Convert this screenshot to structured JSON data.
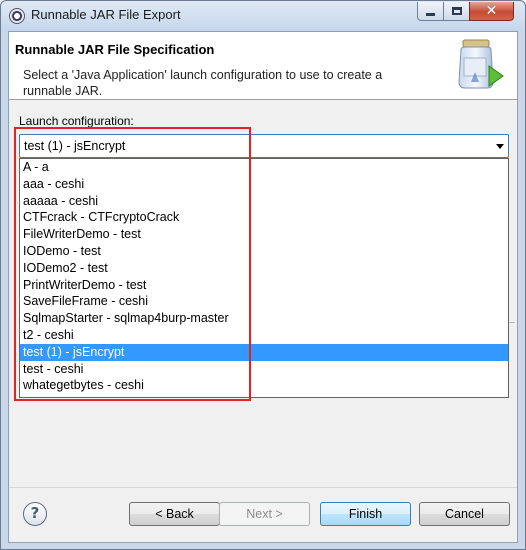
{
  "window": {
    "title": "Runnable JAR File Export"
  },
  "header": {
    "title": "Runnable JAR File Specification",
    "description": "Select a 'Java Application' launch configuration to use to create a runnable JAR."
  },
  "launch": {
    "label": "Launch configuration:",
    "selected": "test (1) - jsEncrypt",
    "options": [
      "A - a",
      "aaa - ceshi",
      "aaaaa - ceshi",
      "CTFcrack - CTFcryptoCrack",
      "FileWriterDemo - test",
      "IODemo - test",
      "IODemo2 - test",
      "PrintWriterDemo - test",
      "SaveFileFrame - ceshi",
      "SqlmapStarter - sqlmap4burp-master",
      "t2 - ceshi",
      "test (1) - jsEncrypt",
      "test - ceshi",
      "whategetbytes - ceshi"
    ]
  },
  "buttons": {
    "back": "< Back",
    "next": "Next >",
    "finish": "Finish",
    "cancel": "Cancel",
    "help": "?"
  },
  "icons": {
    "app": "eclipse-icon",
    "banner": "jar-export-wizard-icon"
  },
  "colors": {
    "selection": "#3399ff",
    "highlight_box": "#e02424"
  }
}
